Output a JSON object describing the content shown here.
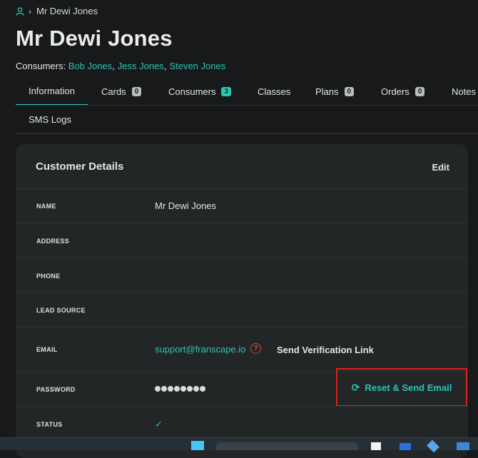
{
  "breadcrumb": {
    "current": "Mr Dewi Jones"
  },
  "header": {
    "title": "Mr Dewi Jones",
    "consumers_label": "Consumers:",
    "consumers": [
      "Bob Jones",
      "Jess Jones",
      "Steven Jones"
    ]
  },
  "tabs": [
    {
      "label": "Information"
    },
    {
      "label": "Cards",
      "badge": "0"
    },
    {
      "label": "Consumers",
      "badge": "3"
    },
    {
      "label": "Classes"
    },
    {
      "label": "Plans",
      "badge": "0"
    },
    {
      "label": "Orders",
      "badge": "0"
    },
    {
      "label": "Notes"
    }
  ],
  "tabs_row2": [
    {
      "label": "SMS Logs"
    }
  ],
  "card": {
    "title": "Customer Details",
    "edit_label": "Edit",
    "fields": {
      "name": {
        "label": "NAME",
        "value": "Mr Dewi Jones"
      },
      "address": {
        "label": "ADDRESS",
        "value": ""
      },
      "phone": {
        "label": "PHONE",
        "value": ""
      },
      "lead_source": {
        "label": "LEAD SOURCE",
        "value": ""
      },
      "email": {
        "label": "EMAIL",
        "value": "support@franscape.io",
        "help": "?",
        "action": "Send Verification Link"
      },
      "password": {
        "label": "PASSWORD",
        "action": "Reset & Send Email"
      },
      "status": {
        "label": "STATUS",
        "value": "✓"
      }
    }
  },
  "colors": {
    "accent": "#2ec4b6",
    "highlight_box": "#e01e1e",
    "background": "#17191a",
    "card": "#222626"
  }
}
